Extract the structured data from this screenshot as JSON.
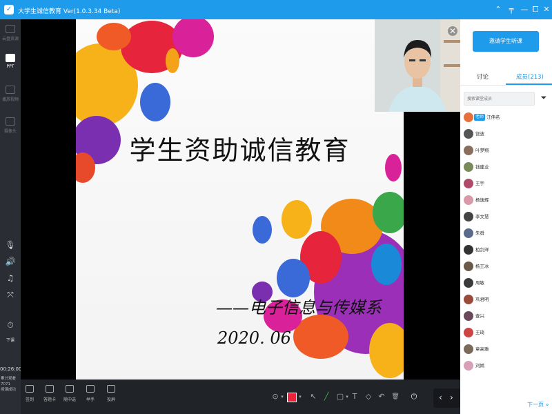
{
  "window": {
    "title": "大学生诚信教育 Ver(1.0.3.34 Beta)",
    "controls": [
      "⌃",
      "╤",
      "—",
      "⧠",
      "✕"
    ]
  },
  "left_sidebar": {
    "items": [
      {
        "label": "云盘资源",
        "icon": "cloud-disk-icon",
        "active": false
      },
      {
        "label": "PPT",
        "icon": "ppt-icon",
        "active": true
      },
      {
        "label": "播放视频",
        "icon": "play-video-icon",
        "active": false
      },
      {
        "label": "摄像头",
        "icon": "camera-icon",
        "active": false
      }
    ],
    "tool_icons": [
      "microphone-icon",
      "speaker-icon",
      "music-icon",
      "fullscreen-icon"
    ],
    "end_class_label": "下课",
    "timer": "00:26:00",
    "stats_line1": "累计观看",
    "stats_line2": "7071",
    "stats_line3": "授课成功"
  },
  "slide": {
    "title": "学生资助诚信教育",
    "subtitle": "——电子信息与传媒系",
    "date": "2020. 06"
  },
  "video": {
    "close": "✕"
  },
  "toolbar": {
    "buttons": [
      {
        "label": "签到",
        "icon": "calendar-icon"
      },
      {
        "label": "答题卡",
        "icon": "answer-card-icon"
      },
      {
        "label": "随中选",
        "icon": "random-pick-icon"
      },
      {
        "label": "举手",
        "icon": "raise-hand-icon"
      },
      {
        "label": "投屏",
        "icon": "screen-share-icon"
      }
    ],
    "tool_glyphs": [
      "⊙",
      "▾",
      "▾",
      "↖",
      "╱",
      "▢",
      "▾",
      "T",
      "◇",
      "↶",
      "🗑",
      "⏻"
    ],
    "pen_color": "#e8253a",
    "prev": "‹",
    "next": "›"
  },
  "right_panel": {
    "invite_button": "邀请学生听课",
    "tabs": [
      {
        "label": "讨论",
        "active": false
      },
      {
        "label": "成员(213)",
        "active": true
      }
    ],
    "search_placeholder": "搜索课堂成员",
    "members": [
      {
        "name": "汪伟名",
        "badge": "老师",
        "color": "#e8703a"
      },
      {
        "name": "饶波",
        "color": "#555"
      },
      {
        "name": "叶梦翔",
        "color": "#8a6d5b"
      },
      {
        "name": "钱建业",
        "color": "#7a8a5b"
      },
      {
        "name": "王宇",
        "color": "#b04a6a"
      },
      {
        "name": "杨逸辉",
        "color": "#d89aa8"
      },
      {
        "name": "李文慧",
        "color": "#444"
      },
      {
        "name": "朱舜",
        "color": "#5a6a8a"
      },
      {
        "name": "柏剑洋",
        "color": "#333"
      },
      {
        "name": "杨王冰",
        "color": "#6a5a4a"
      },
      {
        "name": "周敏",
        "color": "#3a3a3a"
      },
      {
        "name": "巩君明",
        "color": "#9a4a3a"
      },
      {
        "name": "查兴",
        "color": "#6a4a5a"
      },
      {
        "name": "王琦",
        "color": "#c44"
      },
      {
        "name": "章高雅",
        "color": "#7a6a5a"
      },
      {
        "name": "刘嫣",
        "color": "#d8a0b8"
      }
    ],
    "next_page": "下一页 »"
  }
}
